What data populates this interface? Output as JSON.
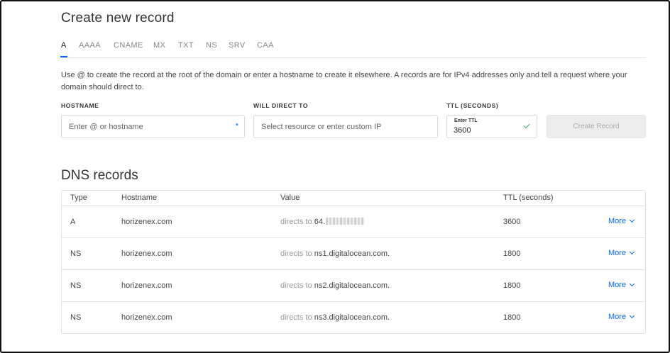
{
  "create": {
    "title": "Create new record",
    "tabs": [
      "A",
      "AAAA",
      "CNAME",
      "MX",
      "TXT",
      "NS",
      "SRV",
      "CAA"
    ],
    "active_tab": "A",
    "help_text": "Use @ to create the record at the root of the domain or enter a hostname to create it elsewhere. A records are for IPv4 addresses only and tell a request where your domain should direct to.",
    "hostname_label": "HOSTNAME",
    "hostname_placeholder": "Enter @ or hostname",
    "hostname_required_mark": "*",
    "direct_label": "WILL DIRECT TO",
    "direct_placeholder": "Select resource or enter custom IP",
    "ttl_label": "TTL (SECONDS)",
    "ttl_inner_label": "Enter TTL",
    "ttl_value": "3600",
    "create_button": "Create Record"
  },
  "dns": {
    "title": "DNS records",
    "headers": {
      "type": "Type",
      "hostname": "Hostname",
      "value": "Value",
      "ttl": "TTL (seconds)"
    },
    "directs_prefix": "directs to",
    "more_label": "More",
    "rows": [
      {
        "type": "A",
        "hostname": "horizenex.com",
        "value": "64.",
        "value_redacted": true,
        "ttl": "3600"
      },
      {
        "type": "NS",
        "hostname": "horizenex.com",
        "value": "ns1.digitalocean.com.",
        "value_redacted": false,
        "ttl": "1800"
      },
      {
        "type": "NS",
        "hostname": "horizenex.com",
        "value": "ns2.digitalocean.com.",
        "value_redacted": false,
        "ttl": "1800"
      },
      {
        "type": "NS",
        "hostname": "horizenex.com",
        "value": "ns3.digitalocean.com.",
        "value_redacted": false,
        "ttl": "1800"
      }
    ]
  },
  "colors": {
    "accent": "#0069ff",
    "check": "#3cb371",
    "disabled_button": "#ececec"
  }
}
